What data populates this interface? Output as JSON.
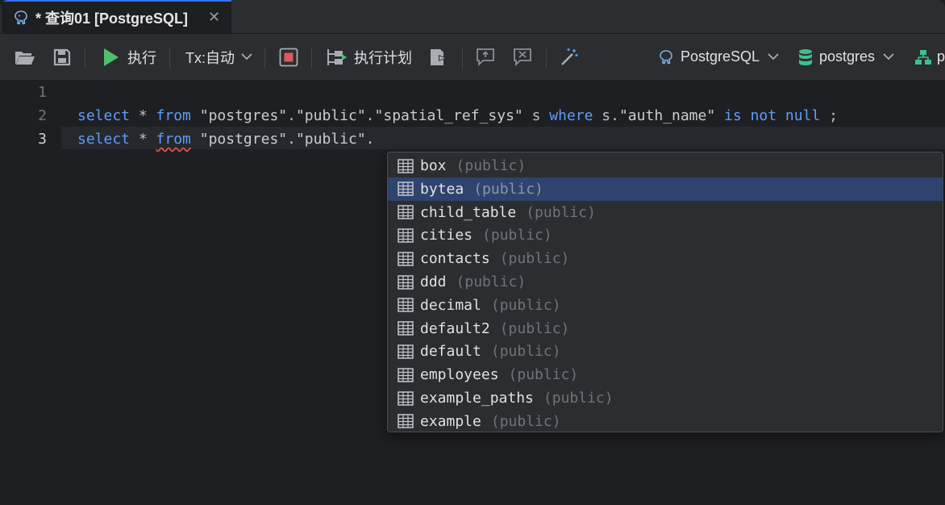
{
  "tab": {
    "title": "* 查询01 [PostgreSQL]",
    "icon": "postgresql-elephant-icon",
    "close": "✕"
  },
  "toolbar": {
    "open_icon": "folder-open-icon",
    "save_icon": "save-icon",
    "run_label": "执行",
    "tx_label": "Tx:自动",
    "stop_icon": "stop-icon",
    "plan_label": "执行计划",
    "export_icon": "export-icon",
    "comment_icon": "comment-icon",
    "uncomment_icon": "uncomment-icon",
    "magic_icon": "magic-wand-icon",
    "datasource_label": "PostgreSQL",
    "database_label": "postgres",
    "schema_label": "p"
  },
  "editor": {
    "line_numbers": [
      "1",
      "2",
      "3"
    ],
    "current_line": "3"
  },
  "completion": {
    "schema_hint": "(public)",
    "items": [
      {
        "name": "box",
        "schema": "(public)"
      },
      {
        "name": "bytea",
        "schema": "(public)"
      },
      {
        "name": "child_table",
        "schema": "(public)"
      },
      {
        "name": "cities",
        "schema": "(public)"
      },
      {
        "name": "contacts",
        "schema": "(public)"
      },
      {
        "name": "ddd",
        "schema": "(public)"
      },
      {
        "name": "decimal",
        "schema": "(public)"
      },
      {
        "name": "default2",
        "schema": "(public)"
      },
      {
        "name": "default",
        "schema": "(public)"
      },
      {
        "name": "employees",
        "schema": "(public)"
      },
      {
        "name": "example_paths",
        "schema": "(public)"
      },
      {
        "name": "example",
        "schema": "(public)"
      }
    ],
    "selected_index": 1
  },
  "colors": {
    "accent": "#3574f0",
    "selection": "#2e436e",
    "keyword": "#5a9ff8",
    "run": "#4fc16a"
  }
}
